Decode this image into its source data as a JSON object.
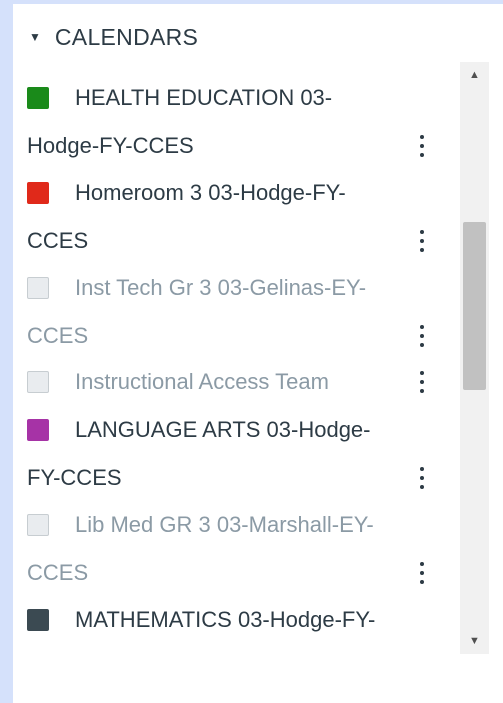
{
  "header": {
    "title": "CALENDARS",
    "caret": "▼"
  },
  "calendars": [
    {
      "line1": "HEALTH EDUCATION 03-",
      "line2": "Hodge-FY-CCES",
      "color": "#1a8a1a",
      "enabled": true
    },
    {
      "line1": "Homeroom 3 03-Hodge-FY-",
      "line2": "CCES",
      "color": "#e0291a",
      "enabled": true
    },
    {
      "line1": "Inst Tech Gr 3 03-Gelinas-EY-",
      "line2": "CCES",
      "color": "#e9ecef",
      "enabled": false
    },
    {
      "line1": "Instructional Access Team",
      "line2": "",
      "color": "#e9ecef",
      "enabled": false
    },
    {
      "line1": "LANGUAGE ARTS 03-Hodge-",
      "line2": "FY-CCES",
      "color": "#a633a6",
      "enabled": true
    },
    {
      "line1": "Lib Med GR 3 03-Marshall-EY-",
      "line2": "CCES",
      "color": "#e9ecef",
      "enabled": false
    },
    {
      "line1": "MATHEMATICS 03-Hodge-FY-",
      "line2": "",
      "color": "#3b4a52",
      "enabled": true
    }
  ],
  "scrollbar": {
    "up_arrow": "▲",
    "down_arrow": "▼"
  }
}
